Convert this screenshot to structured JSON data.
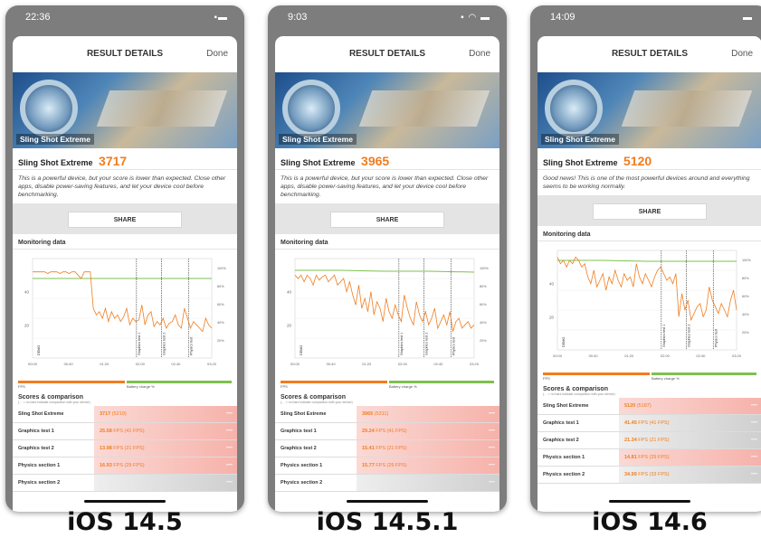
{
  "phones": [
    {
      "status_time": "22:36",
      "status_icons": "▪▬",
      "header": {
        "title": "RESULT DETAILS",
        "done": "Done"
      },
      "banner_label": "Sling Shot Extreme",
      "benchmark_name": "Sling Shot Extreme",
      "score": "3717",
      "description": "This is a powerful device, but your score is lower than expected. Close other apps, disable power-saving features, and let your device cool before benchmarking.",
      "share_label": "SHARE",
      "monitoring_title": "Monitoring data",
      "chart_labels": [
        "DEMO",
        "Graphics test 1",
        "Graphics test 2",
        "Physics test"
      ],
      "y_ticks": [
        "40",
        "20"
      ],
      "pct_ticks": [
        "100%",
        "80%",
        "60%",
        "40%",
        "20%"
      ],
      "x_ticks": [
        "00:00",
        "00:40",
        "01:20",
        "02:00",
        "02:40",
        "03:20"
      ],
      "legend": {
        "fps": "FPS",
        "battery": "Battery charge %"
      },
      "scores_title": "Scores & comparison",
      "scores_subtitle": "(… = no bars indicate comparison with your device)",
      "rows": [
        {
          "label": "Sling Shot Extreme",
          "value": "3717",
          "extra": "(5219)"
        },
        {
          "label": "Graphics test 1",
          "value": "25.58",
          "extra": "FPS (41 FPS)"
        },
        {
          "label": "Graphics test 2",
          "value": "13.98",
          "extra": "FPS (21 FPS)"
        },
        {
          "label": "Physics section 1",
          "value": "16.93",
          "extra": "FPS (29 FPS)"
        },
        {
          "label": "Physics section 2",
          "value": "",
          "extra": ""
        }
      ],
      "caption": "iOS 14.5",
      "series": {
        "battery": [
          88,
          88,
          88,
          88,
          88
        ],
        "fps": [
          52,
          52,
          52,
          52,
          52,
          51,
          52,
          52,
          52,
          51,
          52,
          52,
          51,
          52,
          52,
          50,
          48,
          52,
          52,
          52,
          30,
          26,
          28,
          24,
          30,
          22,
          28,
          24,
          26,
          22,
          25,
          30,
          20,
          24,
          22,
          23,
          32,
          20,
          26,
          28,
          19,
          22,
          20,
          24,
          18,
          21,
          22,
          26,
          20,
          18,
          30,
          24,
          18,
          22,
          20,
          18,
          16,
          24,
          20,
          18
        ]
      }
    },
    {
      "status_time": "9:03",
      "status_icons": "▪ ◠ ▬",
      "header": {
        "title": "RESULT DETAILS",
        "done": "Done"
      },
      "banner_label": "Sling Shot Extreme",
      "benchmark_name": "Sling Shot Extreme",
      "score": "3965",
      "description": "This is a powerful device, but your score is lower than expected. Close other apps, disable power-saving features, and let your device cool before benchmarking.",
      "share_label": "SHARE",
      "monitoring_title": "Monitoring data",
      "chart_labels": [
        "DEMO",
        "Graphics test 1",
        "Graphics test 2",
        "Physics test"
      ],
      "y_ticks": [
        "40",
        "20"
      ],
      "pct_ticks": [
        "100%",
        "80%",
        "60%",
        "40%",
        "20%"
      ],
      "x_ticks": [
        "00:00",
        "00:40",
        "01:20",
        "02:00",
        "02:40",
        "03:20"
      ],
      "legend": {
        "fps": "FPS",
        "battery": "Battery charge %"
      },
      "scores_title": "Scores & comparison",
      "scores_subtitle": "(… = no bars indicate comparison with your device)",
      "rows": [
        {
          "label": "Sling Shot Extreme",
          "value": "3965",
          "extra": "(5311)"
        },
        {
          "label": "Graphics test 1",
          "value": "29.24",
          "extra": "FPS (41 FPS)"
        },
        {
          "label": "Graphics test 2",
          "value": "15.41",
          "extra": "FPS (21 FPS)"
        },
        {
          "label": "Physics section 1",
          "value": "15.77",
          "extra": "FPS (29 FPS)"
        },
        {
          "label": "Physics section 2",
          "value": "",
          "extra": ""
        }
      ],
      "caption": "iOS 14.5.1",
      "series": {
        "battery": [
          97,
          97,
          96,
          96,
          95
        ],
        "fps": [
          50,
          48,
          50,
          46,
          50,
          48,
          44,
          50,
          47,
          49,
          50,
          46,
          48,
          50,
          44,
          46,
          48,
          40,
          46,
          38,
          32,
          44,
          30,
          36,
          28,
          40,
          26,
          34,
          30,
          22,
          36,
          28,
          24,
          32,
          26,
          22,
          38,
          30,
          24,
          20,
          34,
          26,
          22,
          28,
          20,
          24,
          30,
          18,
          22,
          26,
          20,
          28,
          16,
          22,
          24,
          18,
          20,
          22,
          18,
          20
        ]
      }
    },
    {
      "status_time": "14:09",
      "status_icons": "▬",
      "header": {
        "title": "RESULT DETAILS",
        "done": "Done"
      },
      "banner_label": "Sling Shot Extreme",
      "benchmark_name": "Sling Shot Extreme",
      "score": "5120",
      "description": "Good news! This is one of the most powerful devices around and everything seems to be working normally.",
      "share_label": "SHARE",
      "monitoring_title": "Monitoring data",
      "chart_labels": [
        "DEMO",
        "Graphics test 1",
        "Graphics test 2",
        "Physics test"
      ],
      "y_ticks": [
        "40",
        "20"
      ],
      "pct_ticks": [
        "100%",
        "80%",
        "60%",
        "40%",
        "20%"
      ],
      "x_ticks": [
        "00:00",
        "00:40",
        "01:20",
        "02:00",
        "02:40",
        "03:20"
      ],
      "legend": {
        "fps": "FPS",
        "battery": "Battery charge %"
      },
      "scores_title": "Scores & comparison",
      "scores_subtitle": "(… = no bars indicate comparison with your device)",
      "rows": [
        {
          "label": "Sling Shot Extreme",
          "value": "5120",
          "extra": "(5187)"
        },
        {
          "label": "Graphics test 1",
          "value": "41.45",
          "extra": "FPS (41 FPS)"
        },
        {
          "label": "Graphics test 2",
          "value": "21.34",
          "extra": "FPS (21 FPS)"
        },
        {
          "label": "Physics section 1",
          "value": "14.81",
          "extra": "FPS (29 FPS)"
        },
        {
          "label": "Physics section 2",
          "value": "34.99",
          "extra": "FPS (33 FPS)"
        }
      ],
      "caption": "iOS 14.6",
      "series": {
        "battery": [
          99,
          99,
          98,
          98,
          98
        ],
        "fps": [
          56,
          52,
          54,
          50,
          54,
          52,
          56,
          54,
          50,
          52,
          44,
          40,
          48,
          38,
          42,
          46,
          36,
          44,
          40,
          48,
          42,
          38,
          46,
          42,
          44,
          38,
          52,
          44,
          40,
          46,
          42,
          38,
          44,
          48,
          50,
          46,
          42,
          44,
          40,
          46,
          20,
          34,
          24,
          30,
          18,
          22,
          26,
          28,
          20,
          24,
          38,
          30,
          26,
          22,
          28,
          24,
          20,
          30,
          36,
          24
        ]
      }
    }
  ],
  "colors": {
    "accent": "#f07d1f",
    "battery": "#7fc04e",
    "score_row": "#fbd1cd",
    "row_bar": "#dedede"
  }
}
